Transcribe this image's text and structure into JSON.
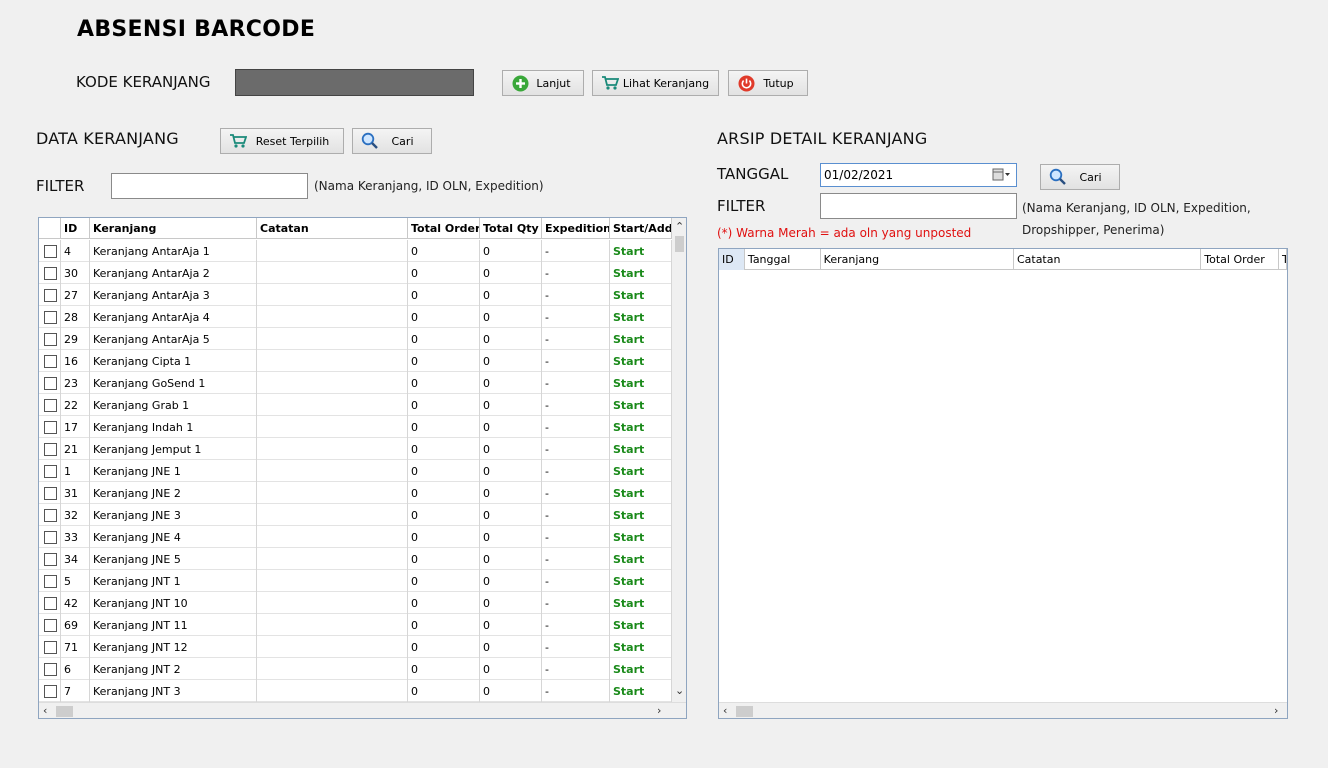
{
  "title": "ABSENSI BARCODE",
  "kode_keranjang": {
    "label": "KODE KERANJANG",
    "value": "",
    "buttons": {
      "lanjut": "Lanjut",
      "lihat": "Lihat Keranjang",
      "tutup": "Tutup"
    }
  },
  "data_keranjang": {
    "title": "DATA KERANJANG",
    "reset_label": "Reset Terpilih",
    "cari_label": "Cari",
    "filter_label": "FILTER",
    "filter_value": "",
    "filter_hint": "(Nama Keranjang, ID OLN, Expedition)",
    "columns": [
      "",
      "ID",
      "Keranjang",
      "Catatan",
      "Total Order",
      "Total Qty",
      "Expedition",
      "Start/Add"
    ],
    "rows": [
      [
        "4",
        "Keranjang AntarAja 1",
        "",
        "0",
        "0",
        "-",
        "Start"
      ],
      [
        "30",
        "Keranjang AntarAja 2",
        "",
        "0",
        "0",
        "-",
        "Start"
      ],
      [
        "27",
        "Keranjang AntarAja 3",
        "",
        "0",
        "0",
        "-",
        "Start"
      ],
      [
        "28",
        "Keranjang AntarAja 4",
        "",
        "0",
        "0",
        "-",
        "Start"
      ],
      [
        "29",
        "Keranjang AntarAja 5",
        "",
        "0",
        "0",
        "-",
        "Start"
      ],
      [
        "16",
        "Keranjang Cipta 1",
        "",
        "0",
        "0",
        "-",
        "Start"
      ],
      [
        "23",
        "Keranjang GoSend 1",
        "",
        "0",
        "0",
        "-",
        "Start"
      ],
      [
        "22",
        "Keranjang Grab 1",
        "",
        "0",
        "0",
        "-",
        "Start"
      ],
      [
        "17",
        "Keranjang Indah 1",
        "",
        "0",
        "0",
        "-",
        "Start"
      ],
      [
        "21",
        "Keranjang Jemput 1",
        "",
        "0",
        "0",
        "-",
        "Start"
      ],
      [
        "1",
        "Keranjang JNE 1",
        "",
        "0",
        "0",
        "-",
        "Start"
      ],
      [
        "31",
        "Keranjang JNE 2",
        "",
        "0",
        "0",
        "-",
        "Start"
      ],
      [
        "32",
        "Keranjang JNE 3",
        "",
        "0",
        "0",
        "-",
        "Start"
      ],
      [
        "33",
        "Keranjang JNE 4",
        "",
        "0",
        "0",
        "-",
        "Start"
      ],
      [
        "34",
        "Keranjang JNE 5",
        "",
        "0",
        "0",
        "-",
        "Start"
      ],
      [
        "5",
        "Keranjang JNT 1",
        "",
        "0",
        "0",
        "-",
        "Start"
      ],
      [
        "42",
        "Keranjang JNT 10",
        "",
        "0",
        "0",
        "-",
        "Start"
      ],
      [
        "69",
        "Keranjang JNT 11",
        "",
        "0",
        "0",
        "-",
        "Start"
      ],
      [
        "71",
        "Keranjang JNT 12",
        "",
        "0",
        "0",
        "-",
        "Start"
      ],
      [
        "6",
        "Keranjang JNT 2",
        "",
        "0",
        "0",
        "-",
        "Start"
      ],
      [
        "7",
        "Keranjang JNT 3",
        "",
        "0",
        "0",
        "-",
        "Start"
      ]
    ]
  },
  "arsip": {
    "title": "ARSIP DETAIL KERANJANG",
    "tanggal_label": "TANGGAL",
    "tanggal_value": "01/02/2021",
    "cari_label": "Cari",
    "filter_label": "FILTER",
    "filter_value": "",
    "filter_hint_line1": "(Nama Keranjang, ID OLN, Expedition,",
    "filter_hint_line2": "Dropshipper, Penerima)",
    "warning": "(*) Warna Merah = ada oln yang unposted",
    "columns": [
      "ID",
      "Tanggal",
      "Keranjang",
      "Catatan",
      "Total Order",
      "T"
    ]
  },
  "colors": {
    "start_text": "#1a8a1a",
    "warning_text": "#e01010",
    "kode_input_bg": "#6b6b6b"
  },
  "icons": {
    "lanjut": "plus-circle-icon",
    "lihat": "cart-icon",
    "tutup": "power-icon",
    "reset": "cart-icon",
    "cari": "magnifier-icon",
    "tanggal": "calendar-icon"
  }
}
